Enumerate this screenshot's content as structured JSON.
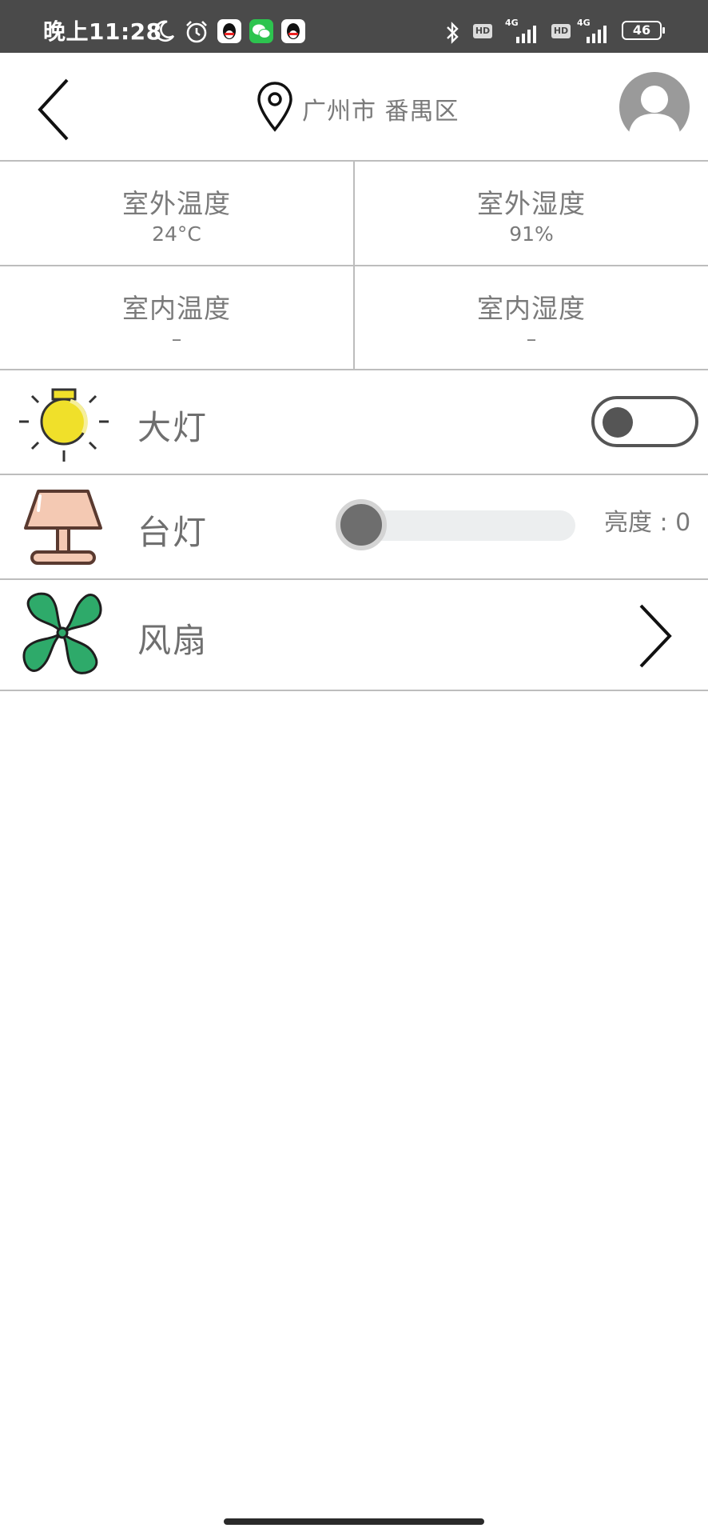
{
  "status_bar": {
    "time": "晚上11:28",
    "icons": [
      "moon-icon",
      "alarm-icon",
      "qq-icon",
      "wechat-icon",
      "qq-icon",
      "bluetooth-icon",
      "hd-icon",
      "signal-4g-icon",
      "hd-icon",
      "signal-4g-icon"
    ],
    "hd_label": "HD",
    "network_label": "4G",
    "battery": "46"
  },
  "header": {
    "location": "广州市 番禺区"
  },
  "info": [
    {
      "label": "室外温度",
      "value": "24°C"
    },
    {
      "label": "室外湿度",
      "value": "91%"
    },
    {
      "label": "室内温度",
      "value": "–"
    },
    {
      "label": "室内湿度",
      "value": "–"
    }
  ],
  "devices": {
    "main_light": {
      "name": "大灯",
      "on": false
    },
    "desk_lamp": {
      "name": "台灯",
      "brightness_label": "亮度 : 0",
      "brightness": 0
    },
    "fan": {
      "name": "风扇"
    }
  },
  "colors": {
    "status_bar": "#4a4a4a",
    "divider": "#bdbdbd",
    "text": "#7a7a7a",
    "bulb": "#f0e02a",
    "lamp_shade": "#f4c9b3",
    "fan": "#2eaa6a"
  }
}
